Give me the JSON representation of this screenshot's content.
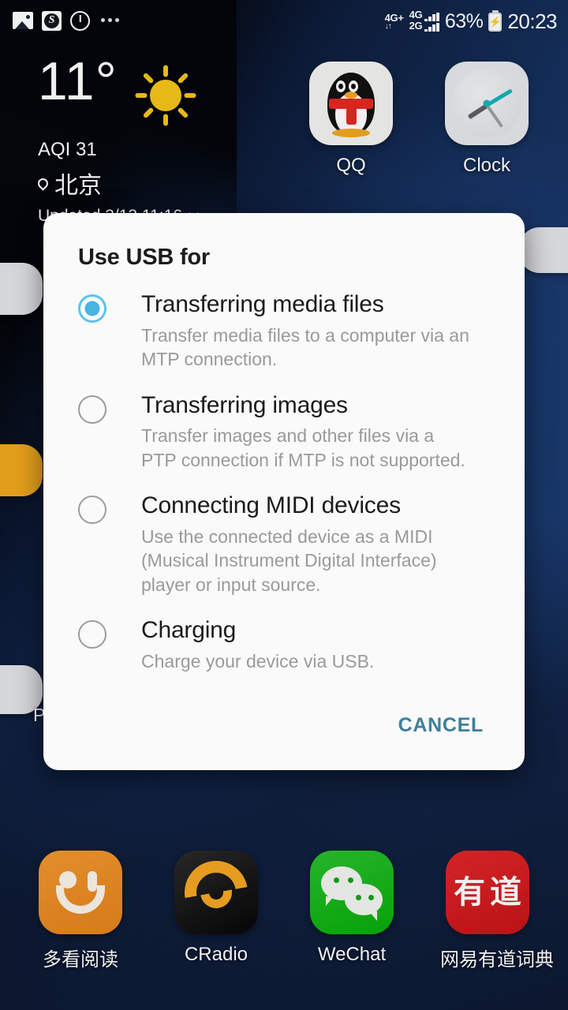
{
  "status_bar": {
    "left_icons": [
      "photo-icon",
      "s-app-icon",
      "power-timer-icon",
      "more-dots-icon"
    ],
    "sim1_label": "4G+",
    "sim1_arrows": "↓↑",
    "sim2_label": "4G",
    "sim3_label": "2G",
    "battery_percent": "63%",
    "battery_state": "charging",
    "battery_glyph": "⚡",
    "time": "20:23"
  },
  "weather_widget": {
    "temperature": "11°",
    "condition_icon": "sun-icon",
    "aqi": "AQI 31",
    "city": "北京",
    "updated": "Updated 3/13  11:16"
  },
  "home_apps": [
    {
      "label": "QQ",
      "icon": "qq-icon"
    },
    {
      "label": "Clock",
      "icon": "clock-icon"
    }
  ],
  "dock_apps": [
    {
      "label": "多看阅读",
      "icon": "duokan-reading-icon"
    },
    {
      "label": "CRadio",
      "icon": "cradio-icon"
    },
    {
      "label": "WeChat",
      "icon": "wechat-icon"
    },
    {
      "label": "网易有道词典",
      "icon": "youdao-dictionary-icon",
      "char1": "有",
      "char2": "道"
    }
  ],
  "hidden_app_label": "P",
  "dialog": {
    "title": "Use USB for",
    "selected_index": 0,
    "options": [
      {
        "title": "Transferring media files",
        "description": "Transfer media files to a computer via an MTP connection.",
        "selected": true
      },
      {
        "title": "Transferring images",
        "description": "Transfer images and other files via a PTP connection if MTP is not supported.",
        "selected": false
      },
      {
        "title": "Connecting MIDI devices",
        "description": "Use the connected device as a MIDI (Musical Instrument Digital Interface) player or input source.",
        "selected": false
      },
      {
        "title": "Charging",
        "description": "Charge your device via USB.",
        "selected": false
      }
    ],
    "cancel_label": "CANCEL"
  },
  "colors": {
    "accent_radio": "#49b4e4",
    "cancel_text": "#3e7f9c",
    "dialog_bg": "#fafafa",
    "wallpaper_navy": "#16315e",
    "sun_yellow": "#f5c518"
  }
}
